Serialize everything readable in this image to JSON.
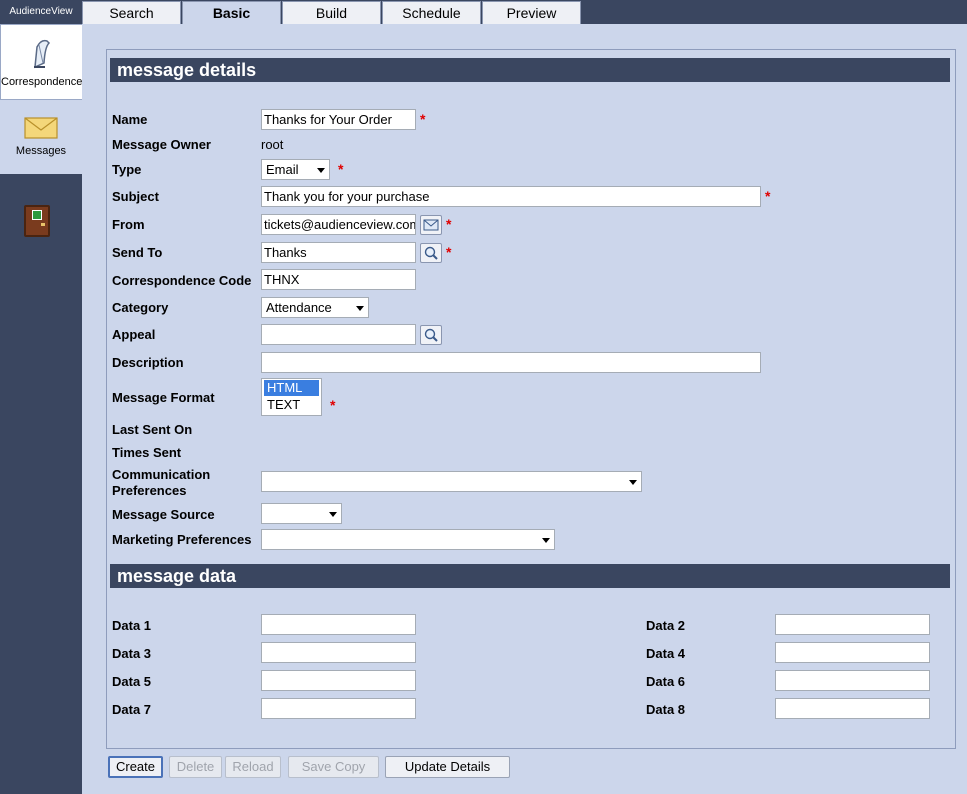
{
  "app": {
    "title": "AudienceView"
  },
  "sidebar": {
    "items": [
      {
        "label": "Correspondence",
        "icon": "quill-pen-icon",
        "active": true
      },
      {
        "label": "Messages",
        "icon": "envelope-icon",
        "active": false
      }
    ],
    "exit_icon": "exit-door-icon"
  },
  "tabs": [
    {
      "label": "Search"
    },
    {
      "label": "Basic"
    },
    {
      "label": "Build"
    },
    {
      "label": "Schedule"
    },
    {
      "label": "Preview"
    }
  ],
  "details": {
    "header": "message details",
    "name_label": "Name",
    "name_value": "Thanks for Your Order",
    "owner_label": "Message Owner",
    "owner_value": "root",
    "type_label": "Type",
    "type_value": "Email",
    "subject_label": "Subject",
    "subject_value": "Thank you for your purchase",
    "from_label": "From",
    "from_value": "tickets@audienceview.com",
    "sendto_label": "Send To",
    "sendto_value": "Thanks",
    "code_label": "Correspondence Code",
    "code_value": "THNX",
    "category_label": "Category",
    "category_value": "Attendance",
    "appeal_label": "Appeal",
    "appeal_value": "",
    "description_label": "Description",
    "description_value": "",
    "format_label": "Message Format",
    "format_options": [
      "HTML",
      "TEXT"
    ],
    "last_sent_label": "Last Sent On",
    "times_sent_label": "Times Sent",
    "comm_pref_label_1": "Communication",
    "comm_pref_label_2": "Preferences",
    "comm_pref_value": "",
    "source_label": "Message Source",
    "source_value": "",
    "marketing_label": "Marketing Preferences",
    "marketing_value": "",
    "required_mark": "*"
  },
  "data_section": {
    "header": "message data",
    "fields": [
      {
        "label": "Data 1",
        "value": ""
      },
      {
        "label": "Data 2",
        "value": ""
      },
      {
        "label": "Data 3",
        "value": ""
      },
      {
        "label": "Data 4",
        "value": ""
      },
      {
        "label": "Data 5",
        "value": ""
      },
      {
        "label": "Data 6",
        "value": ""
      },
      {
        "label": "Data 7",
        "value": ""
      },
      {
        "label": "Data 8",
        "value": ""
      }
    ]
  },
  "buttons": {
    "create": "Create",
    "delete": "Delete",
    "reload": "Reload",
    "save_copy": "Save Copy",
    "update_details": "Update Details"
  },
  "colors": {
    "accent": "#3a4660",
    "panel": "#ccd6eb",
    "required": "#e00000",
    "selected": "#3a7ee0"
  }
}
